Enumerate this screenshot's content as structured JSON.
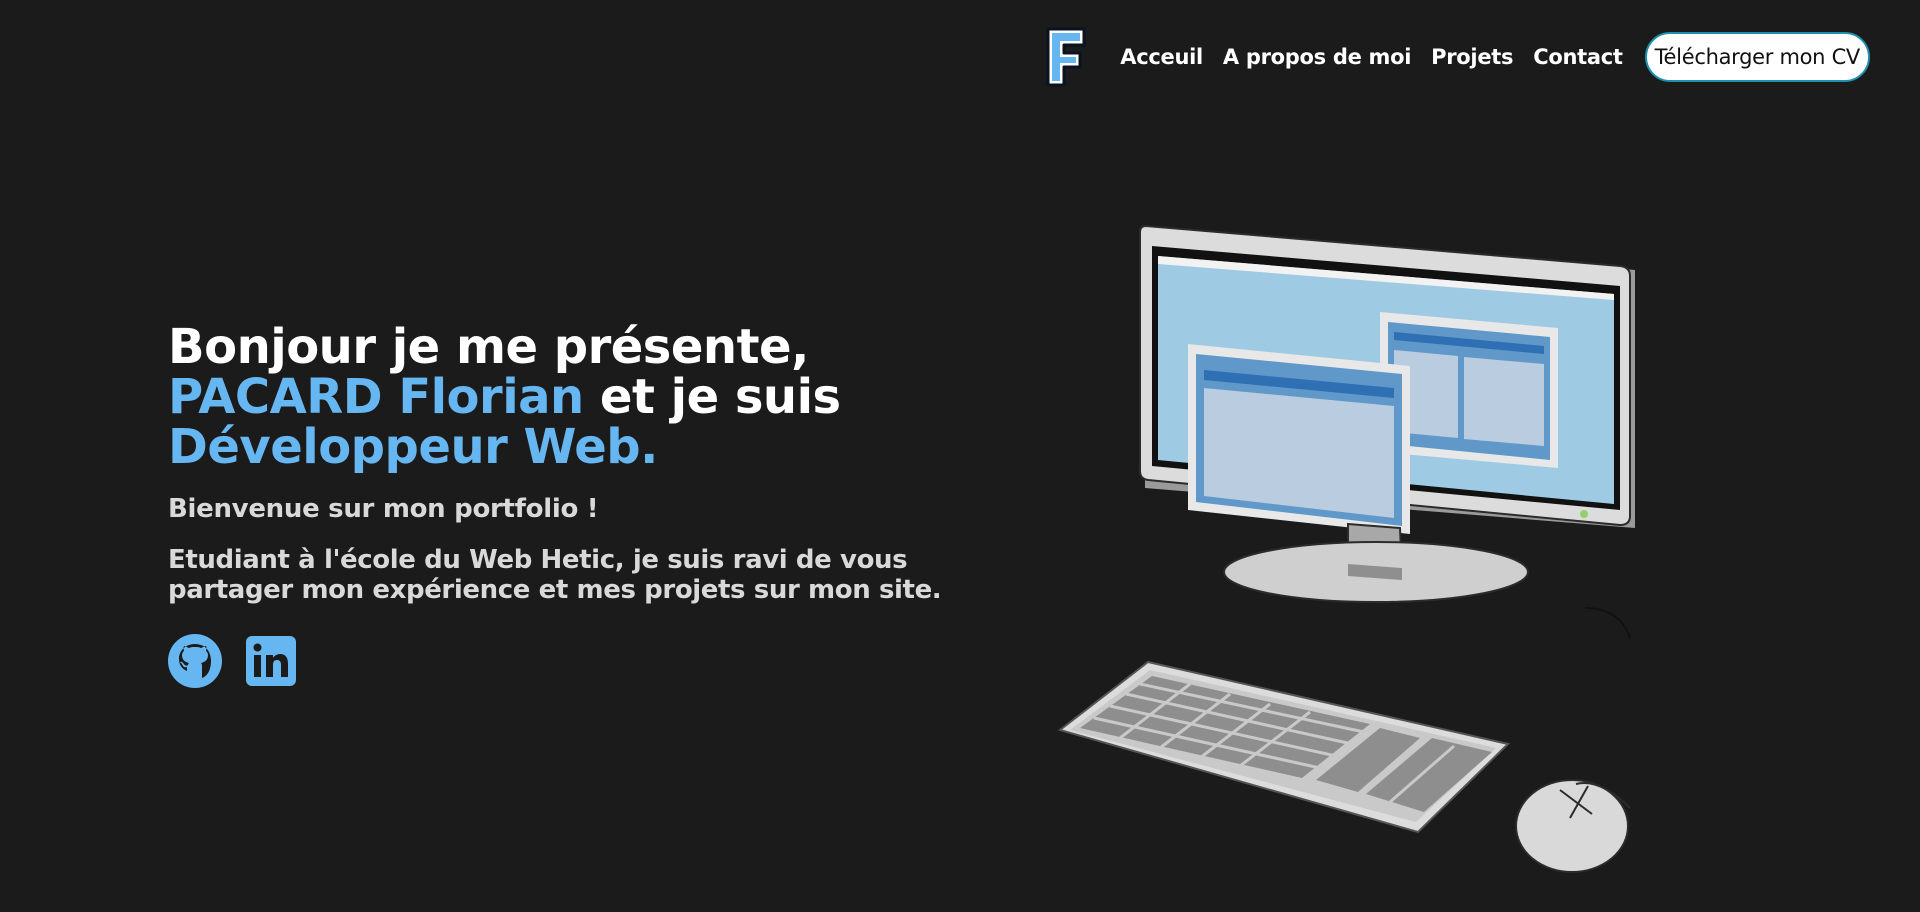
{
  "nav": {
    "logo_letter": "F",
    "links": [
      "Acceuil",
      "A propos de moi",
      "Projets",
      "Contact"
    ],
    "cv_button": "Télécharger mon CV"
  },
  "hero": {
    "line1": "Bonjour je me présente,",
    "name": "PACARD Florian",
    "line2_rest": " et je suis",
    "role": "Développeur Web.",
    "intro": "Bienvenue sur mon portfolio !",
    "description": "Etudiant à l'école du Web Hetic, je suis ravi de vous partager mon expérience et mes projets sur mon site."
  },
  "socials": [
    {
      "icon": "github-icon"
    },
    {
      "icon": "linkedin-icon"
    }
  ],
  "colors": {
    "background": "#1b1b1b",
    "accent": "#66b7f1",
    "text": "#ffffff",
    "muted_text": "#d9d9d9"
  }
}
